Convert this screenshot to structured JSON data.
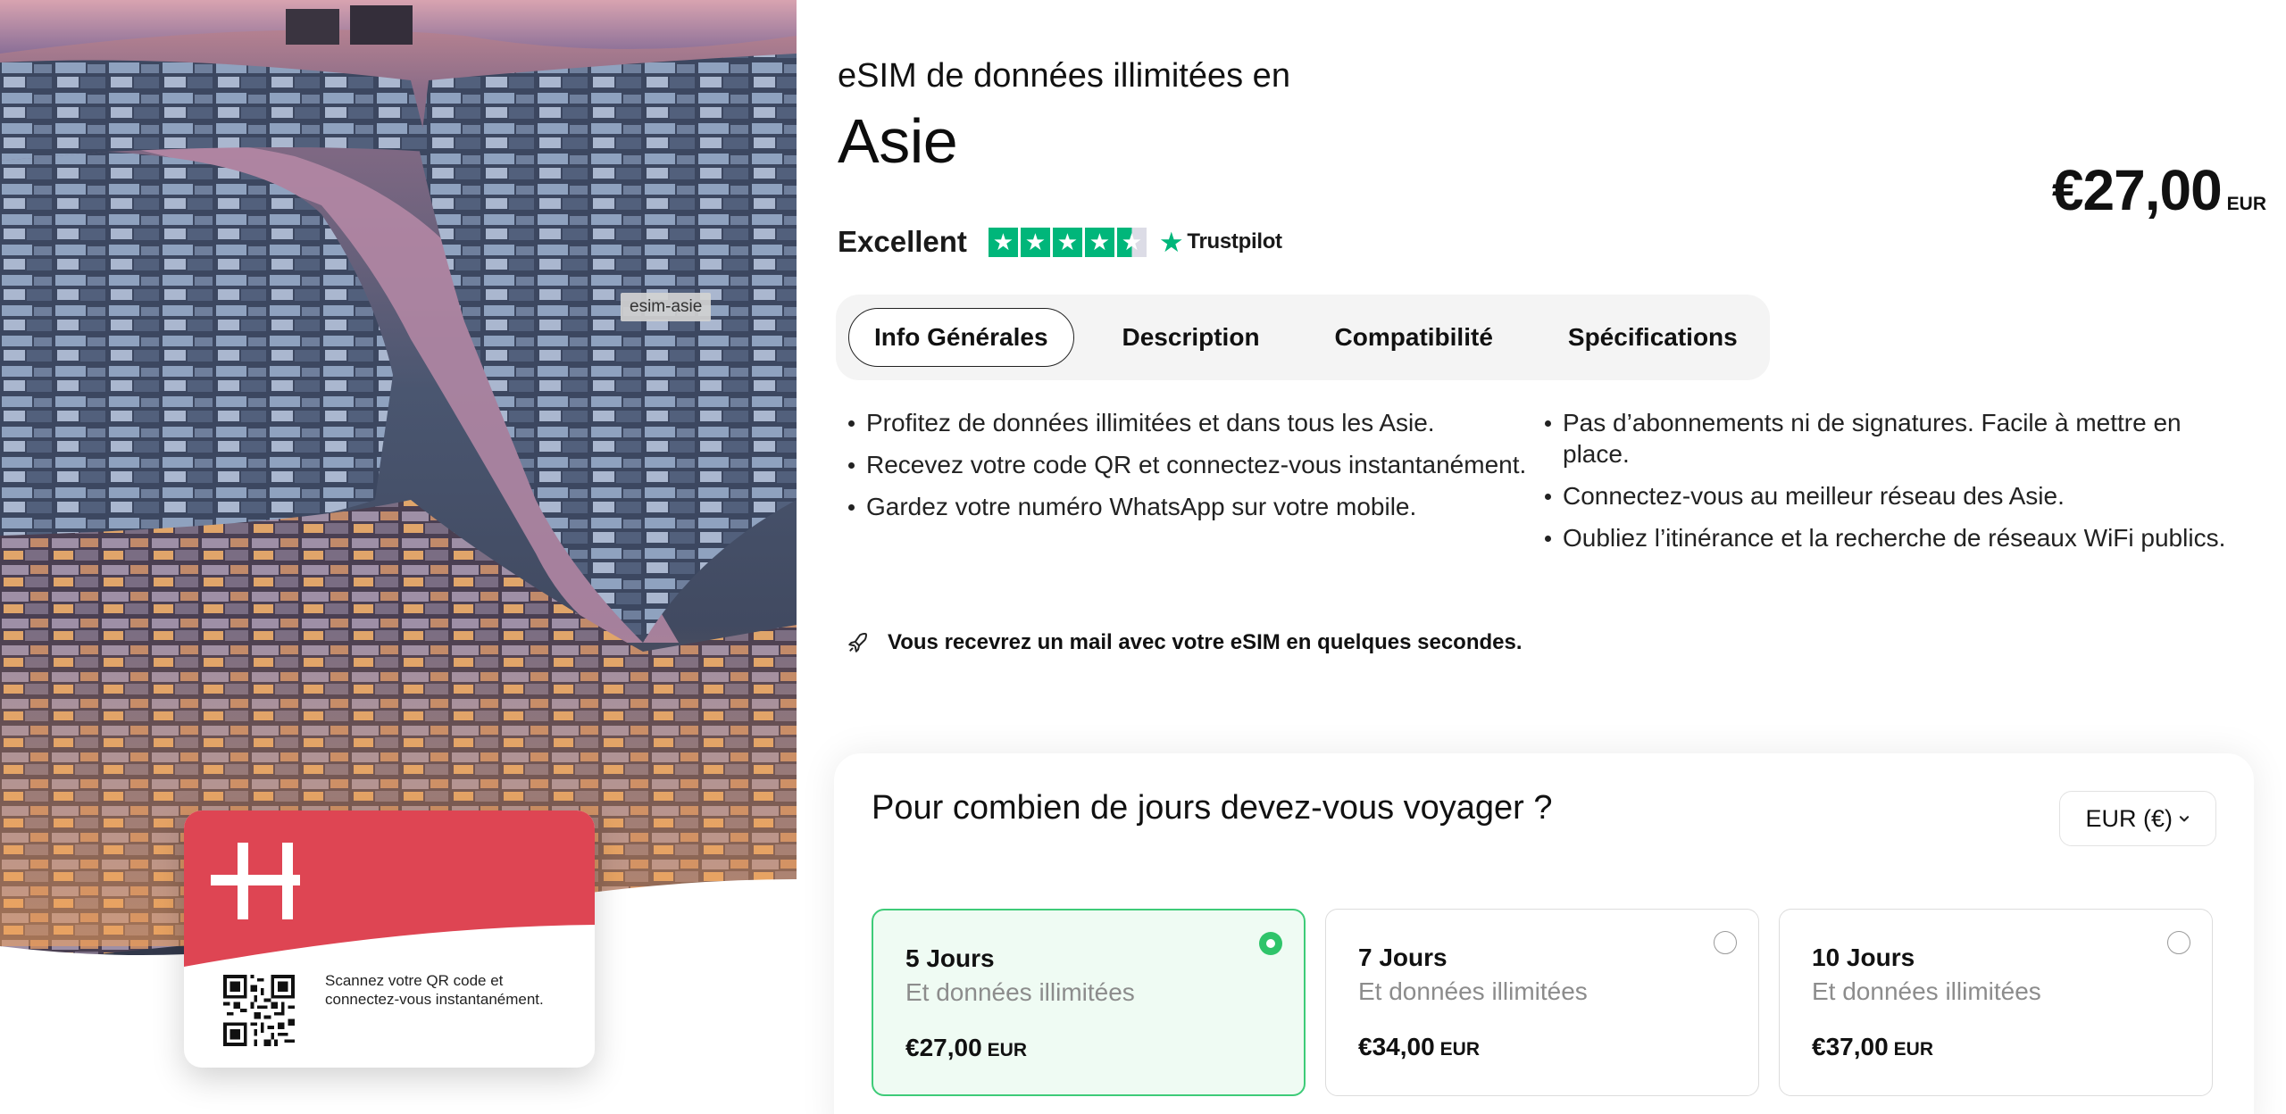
{
  "hero": {
    "image_tag": "esim-asie",
    "card": {
      "logo_icon": "hollow-h-logo-icon",
      "brand_color": "#de4553",
      "qr_icon": "qr-code-icon",
      "instruction": "Scannez votre QR code et connectez-vous instantanément."
    }
  },
  "product": {
    "subtitle": "eSIM de données illimitées en",
    "title": "Asie",
    "price": "€27,00",
    "currency": "EUR"
  },
  "rating": {
    "label": "Excellent",
    "stars": 4.5,
    "provider": "Trustpilot",
    "accent_color": "#00b67a"
  },
  "tabs": [
    {
      "label": "Info Générales",
      "active": true
    },
    {
      "label": "Description",
      "active": false
    },
    {
      "label": "Compatibilité",
      "active": false
    },
    {
      "label": "Spécifications",
      "active": false
    }
  ],
  "features": {
    "left": [
      "Profitez de données illimitées et dans tous les Asie.",
      "Recevez votre code QR et connectez-vous instantanément.",
      "Gardez votre numéro WhatsApp sur votre mobile."
    ],
    "right": [
      "Pas d’abonnements ni de signatures. Facile à mettre en place.",
      "Connectez-vous au meilleur réseau des Asie.",
      "Oubliez l’itinérance et la recherche de réseaux WiFi publics."
    ]
  },
  "notice": {
    "icon": "rocket-icon",
    "text": "Vous recevrez un mail avec votre eSIM en quelques secondes."
  },
  "booking": {
    "question": "Pour combien de jours devez-vous voyager ?",
    "currency_selector": "EUR (€)",
    "plans": [
      {
        "name": "5 Jours",
        "desc": "Et données illimitées",
        "price": "€27,00",
        "currency": "EUR",
        "selected": true
      },
      {
        "name": "7 Jours",
        "desc": "Et données illimitées",
        "price": "€34,00",
        "currency": "EUR",
        "selected": false
      },
      {
        "name": "10 Jours",
        "desc": "Et données illimitées",
        "price": "€37,00",
        "currency": "EUR",
        "selected": false
      }
    ],
    "selected_color": "#2fc46a"
  }
}
